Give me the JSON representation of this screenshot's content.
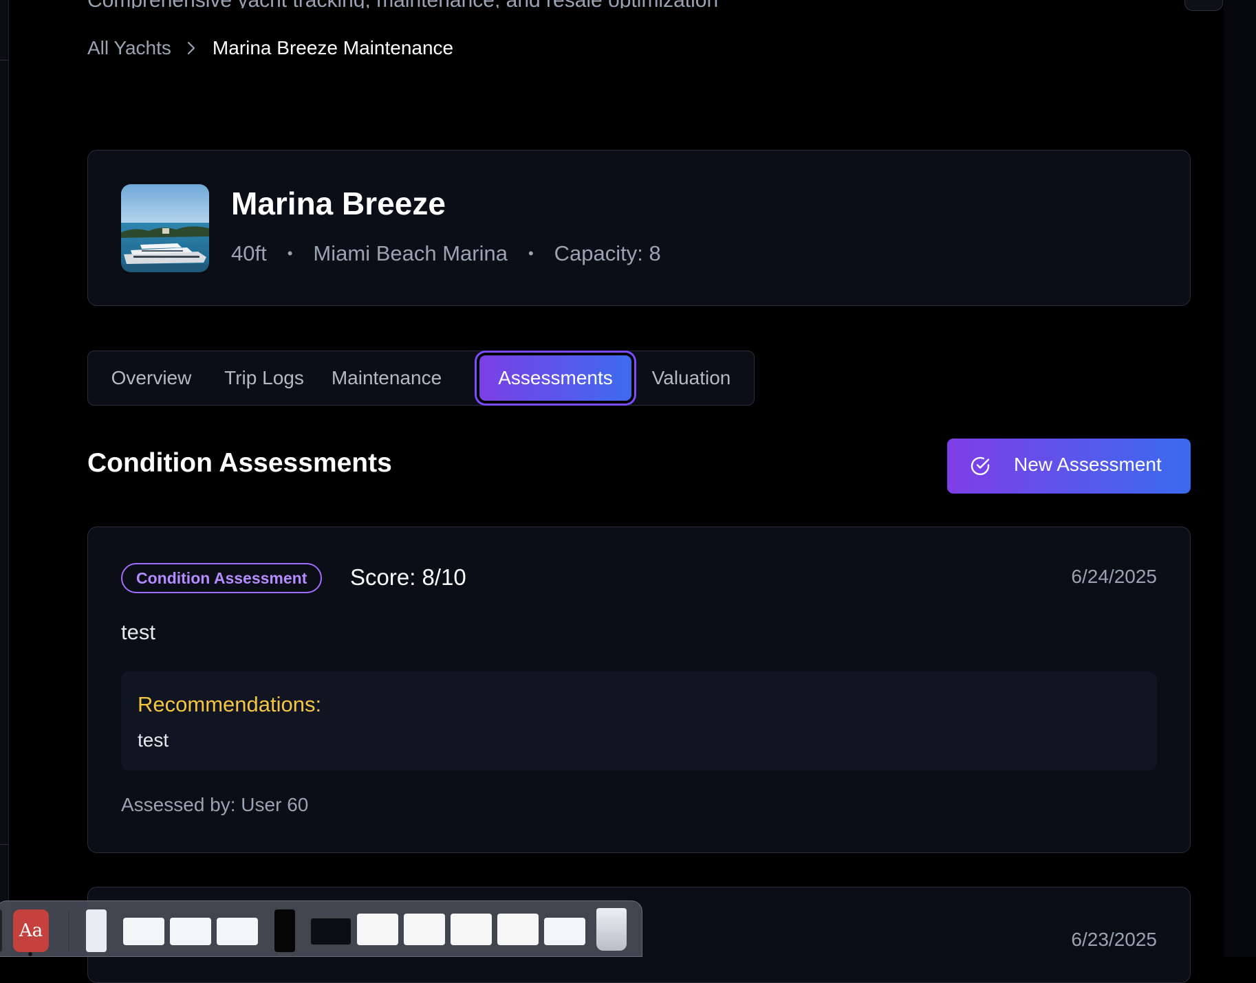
{
  "header": {
    "subtitle": "Comprehensive yacht tracking, maintenance, and resale optimization"
  },
  "breadcrumb": {
    "root": "All Yachts",
    "current": "Marina Breeze Maintenance"
  },
  "yacht": {
    "name": "Marina Breeze",
    "length": "40ft",
    "location": "Miami Beach Marina",
    "capacity": "Capacity: 8",
    "separator": "•"
  },
  "tabs": [
    {
      "label": "Overview",
      "active": false
    },
    {
      "label": "Trip Logs",
      "active": false
    },
    {
      "label": "Maintenance",
      "active": false
    },
    {
      "label": "Assessments",
      "active": true
    },
    {
      "label": "Valuation",
      "active": false
    }
  ],
  "section": {
    "title": "Condition Assessments",
    "new_button_label": "New Assessment",
    "new_button_icon": "check-circle-icon"
  },
  "assessments": [
    {
      "type_badge": "Condition Assessment",
      "score": "Score: 8/10",
      "date": "6/24/2025",
      "description": "test",
      "recommendations_title": "Recommendations:",
      "recommendations": "test",
      "assessor": "Assessed by: User 60"
    },
    {
      "date": "6/23/2025"
    }
  ],
  "colors": {
    "accent_gradient_start": "#7e3ee6",
    "accent_gradient_end": "#3a6bef",
    "badge_purple": "#a36bff",
    "recommendations_yellow": "#f5c542",
    "card_bg": "#0b0e16"
  },
  "dock": {
    "items": [
      "dictionary-app-icon",
      "document-window-icon",
      "finder-window-icon",
      "finder-window-icon",
      "finder-window-icon",
      "phone-screen-icon",
      "terminal-window-icon",
      "preview-document-icon",
      "preview-document-icon",
      "preview-document-icon",
      "preview-document-icon",
      "chrome-window-icon",
      "trash-icon"
    ],
    "dictionary_label": "Aa"
  }
}
